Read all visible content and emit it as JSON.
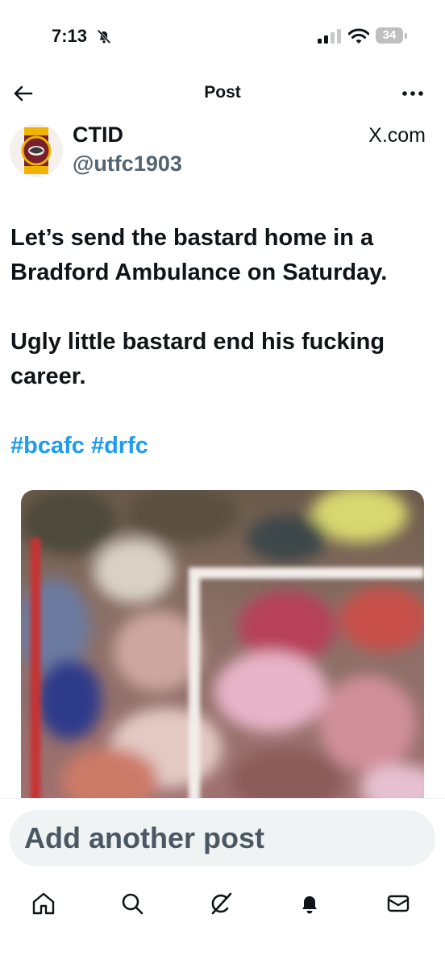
{
  "status": {
    "time": "7:13",
    "battery": "34"
  },
  "header": {
    "title": "Post"
  },
  "post": {
    "author_name": "CTID",
    "author_handle": "@utfc1903",
    "source": "X.com",
    "lines": [
      "Let’s send the bastard home in a",
      "Bradford Ambulance on Saturday.",
      "Ugly little bastard end his fucking",
      "career."
    ],
    "hashtags": [
      "#bcafc",
      "#drfc"
    ],
    "media": {
      "type": "photo",
      "description_icon": "blurred-football-goal-image"
    }
  },
  "compose": {
    "placeholder": "Add another post"
  },
  "tabbar": [
    "home-icon",
    "search-icon",
    "grok-icon",
    "notifications-icon",
    "messages-icon"
  ],
  "colors": {
    "hashtag": "#1d9bf0",
    "handle": "#536471",
    "text": "#0f1419",
    "compose_bg": "#eff3f4"
  }
}
